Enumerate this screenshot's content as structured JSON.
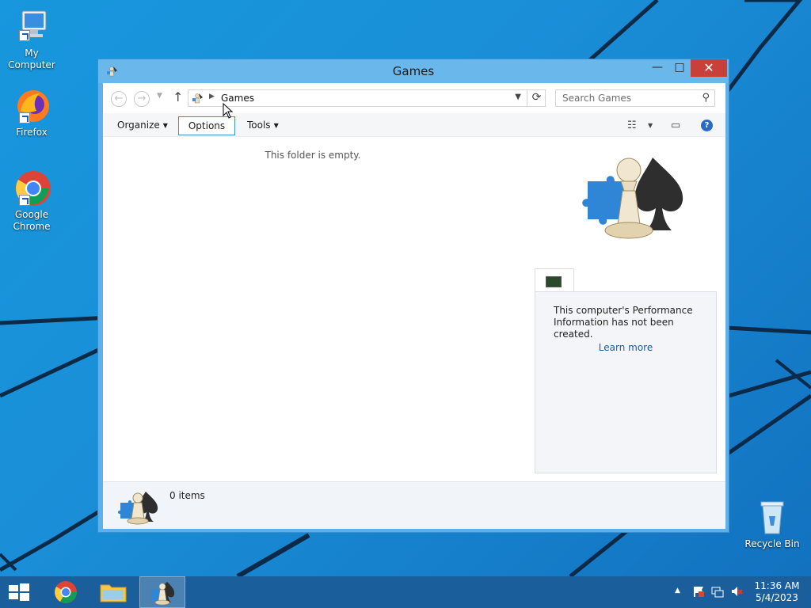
{
  "desktop": {
    "icons": [
      {
        "label": "My Computer",
        "icon": "computer-icon"
      },
      {
        "label": "Firefox",
        "icon": "firefox-icon"
      },
      {
        "label": "Google Chrome",
        "icon": "chrome-icon"
      },
      {
        "label": "Recycle Bin",
        "icon": "recycle-bin-icon"
      }
    ]
  },
  "window": {
    "title": "Games",
    "buttons": {
      "minimize": "—",
      "maximize": "□",
      "close": "✕"
    },
    "address": {
      "crumb": "Games",
      "search_placeholder": "Search Games"
    },
    "toolbar": {
      "organize": "Organize",
      "options": "Options",
      "tools": "Tools"
    },
    "content": {
      "empty_message": "This folder is empty."
    },
    "side_pane": {
      "performance_message": "This computer's Performance Information has not been created.",
      "learn_more": "Learn more"
    },
    "details": {
      "item_count": "0 items"
    }
  },
  "taskbar": {
    "items": [
      "start-button",
      "chrome",
      "file-explorer",
      "games"
    ],
    "active": "games",
    "clock_time": "11:36 AM",
    "clock_date": "5/4/2023"
  },
  "colors": {
    "accent": "#3d8fd0",
    "close_button": "#c7403a",
    "taskbar": "#1a5f9c",
    "link": "#1e5b9e"
  }
}
